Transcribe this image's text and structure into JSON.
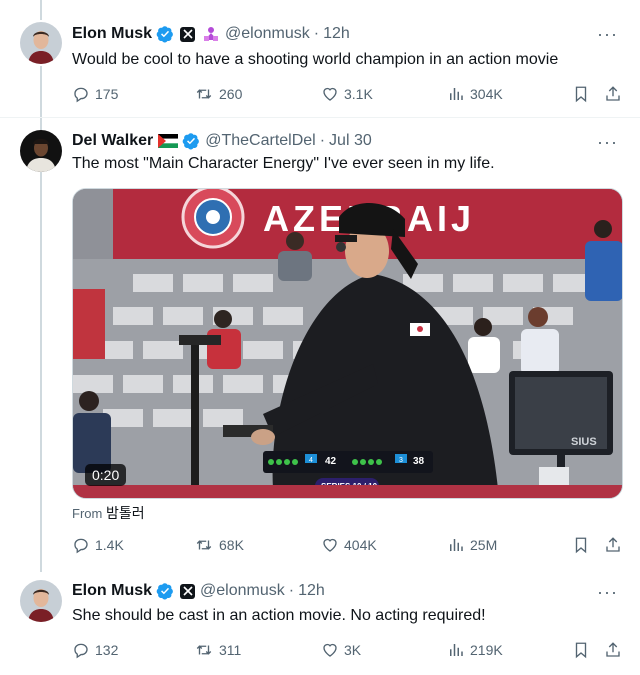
{
  "tweets": [
    {
      "name": "Elon Musk",
      "handle": "@elonmusk",
      "time": "12h",
      "text": "Would be cool to have a shooting world champion in an action movie",
      "stats": {
        "replies": "175",
        "reposts": "260",
        "likes": "3.1K",
        "views": "304K"
      }
    },
    {
      "name": "Del Walker",
      "flag": "palestine-flag",
      "handle": "@TheCartelDel",
      "time": "Jul 30",
      "text": "The most \"Main Character Energy\" I've ever seen in my life.",
      "media": {
        "duration": "0:20",
        "from_label": "From",
        "from_user": "밤톨러",
        "banner_text": "AZERBAIJ",
        "scoreboard": {
          "score_left": "42",
          "score_right": "38",
          "shots_left": "4",
          "shots_right": "3",
          "series": "SERIES 10 / 10"
        },
        "monitor_brand": "SIUS"
      },
      "stats": {
        "replies": "1.4K",
        "reposts": "68K",
        "likes": "404K",
        "views": "25M"
      }
    },
    {
      "name": "Elon Musk",
      "handle": "@elonmusk",
      "time": "12h",
      "text": "She should be cast in an action movie. No  acting required!",
      "stats": {
        "replies": "132",
        "reposts": "311",
        "likes": "3K",
        "views": "219K"
      }
    }
  ],
  "dot": "·",
  "more": "···",
  "colors": {
    "verified": "#1d9bf0",
    "muted": "#536471",
    "text": "#0f1419",
    "line": "#cfd9de"
  }
}
